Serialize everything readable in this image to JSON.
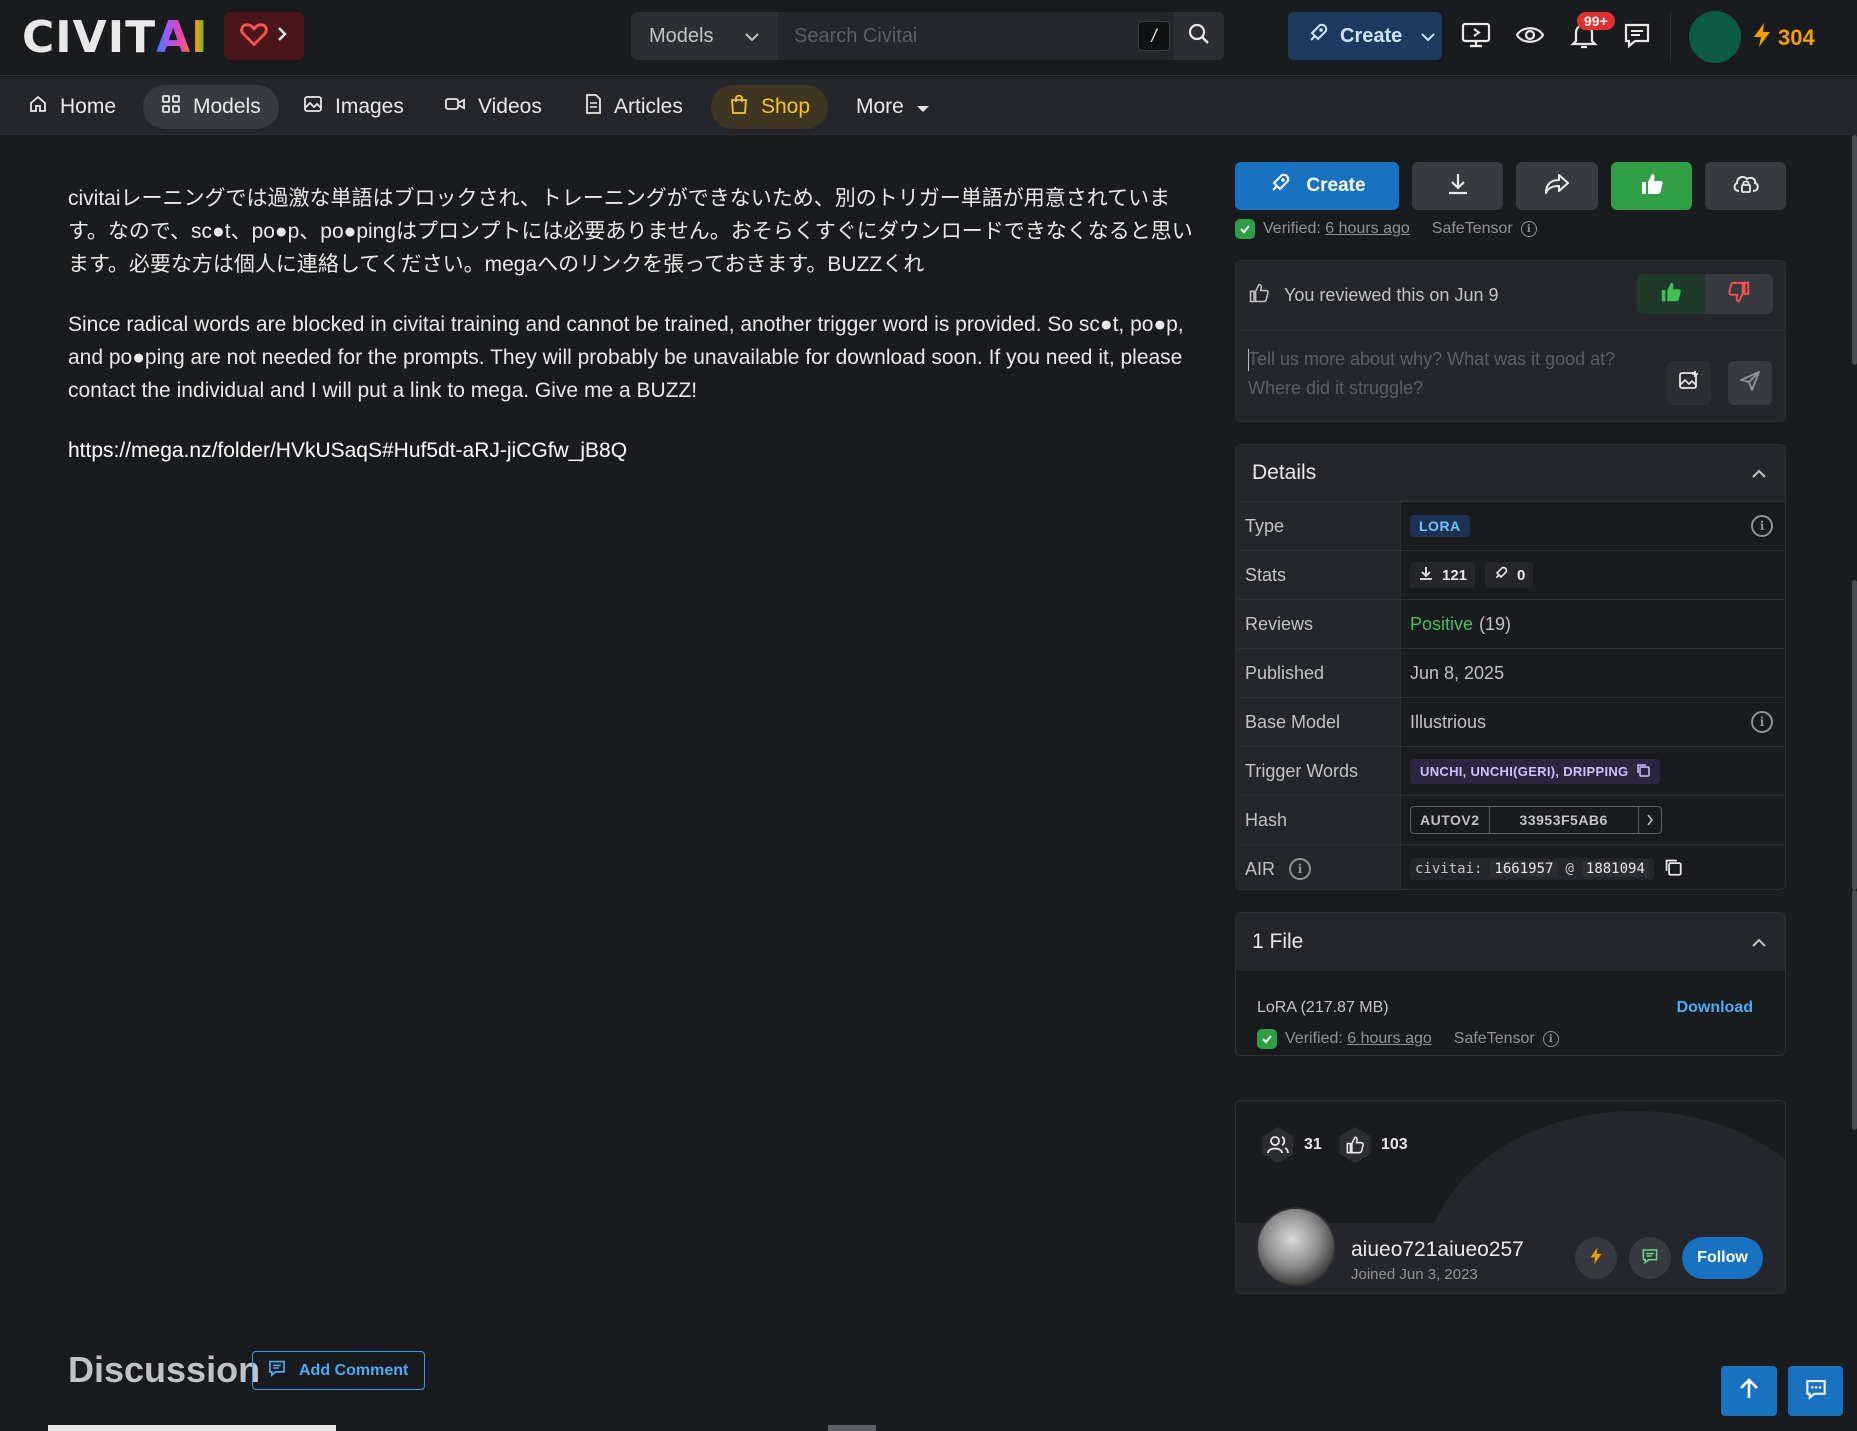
{
  "header": {
    "logo_text_a": "CIVIT",
    "logo_text_b": "AI",
    "search": {
      "category": "Models",
      "placeholder": "Search Civitai",
      "shortcut": "/"
    },
    "create_label": "Create",
    "notifications_badge": "99+",
    "buzz_amount": "304",
    "icons": [
      "heart-icon",
      "chevron-right-icon",
      "chevron-down-icon",
      "search-icon",
      "rocket-icon",
      "monitor-icon",
      "eye-icon",
      "bell-icon",
      "chat-icon",
      "bolt-icon"
    ]
  },
  "nav": {
    "items": [
      {
        "label": "Home",
        "icon": "home-icon"
      },
      {
        "label": "Models",
        "icon": "grid-icon",
        "active": true
      },
      {
        "label": "Images",
        "icon": "image-icon"
      },
      {
        "label": "Videos",
        "icon": "video-icon"
      },
      {
        "label": "Articles",
        "icon": "article-icon"
      },
      {
        "label": "Shop",
        "icon": "shopping-bag-icon"
      },
      {
        "label": "More",
        "icon": "caret-down-icon"
      }
    ]
  },
  "description": {
    "paragraph_ja": "civitaiレーニングでは過激な単語はブロックされ、トレーニングができないため、別のトリガー単語が用意されています。なので、sc●t、po●p、po●pingはプロンプトには必要ありません。おそらくすぐにダウンロードできなくなると思います。必要な方は個人に連絡してください。megaへのリンクを張っておきます。BUZZくれ",
    "paragraph_en": "Since radical words are blocked in civitai training and cannot be trained, another trigger word is provided. So sc●t, po●p, and po●ping are not needed for the prompts. They will probably be unavailable for download soon. If you need it, please contact the individual and I will put a link to mega. Give me a BUZZ!",
    "link": "https://mega.nz/folder/HVkUSaqS#Huf5dt-aRJ-jiCGfw_jB8Q"
  },
  "actions": {
    "create_label": "Create",
    "verified_label": "Verified:",
    "verified_time": "6 hours ago",
    "format": "SafeTensor"
  },
  "review": {
    "text": "You reviewed this on Jun 9",
    "placeholder": "Tell us more about why? What was it good at? Where did it struggle?"
  },
  "details": {
    "title": "Details",
    "rows": {
      "type": {
        "label": "Type",
        "value": "LORA"
      },
      "stats": {
        "label": "Stats",
        "downloads": "121",
        "generations": "0"
      },
      "reviews": {
        "label": "Reviews",
        "sentiment": "Positive",
        "count": "(19)"
      },
      "published": {
        "label": "Published",
        "value": "Jun 8, 2025"
      },
      "base_model": {
        "label": "Base Model",
        "value": "Illustrious"
      },
      "trigger_words": {
        "label": "Trigger Words",
        "value": "UNCHI, UNCHI(GERI), DRIPPING"
      },
      "hash": {
        "label": "Hash",
        "algo": "AUTOV2",
        "value": "33953F5AB6"
      },
      "air": {
        "label": "AIR",
        "prefix": "civitai:",
        "model_id": "1661957",
        "at": "@",
        "version_id": "1881094"
      }
    }
  },
  "files": {
    "title": "1 File",
    "file_name": "LoRA (217.87 MB)",
    "download_label": "Download",
    "verified_label": "Verified:",
    "verified_time": "6 hours ago",
    "format": "SafeTensor"
  },
  "creator": {
    "followers": "31",
    "likes": "103",
    "username": "aiueo721aiueo257",
    "joined": "Joined Jun 3, 2023",
    "follow_label": "Follow"
  },
  "discussion": {
    "title": "Discussion",
    "add_comment_label": "Add Comment"
  },
  "colors": {
    "accent_blue": "#1971c2",
    "like_green": "#2f9e44",
    "shop_yellow": "#fcc419",
    "buzz_orange": "#f59f00",
    "positive_green": "#40c057"
  }
}
